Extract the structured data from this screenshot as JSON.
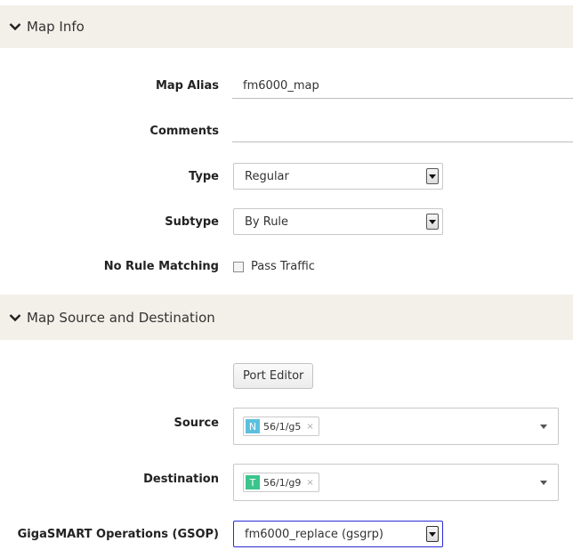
{
  "sections": {
    "map_info": {
      "title": "Map Info"
    },
    "map_source_destination": {
      "title": "Map Source and Destination"
    }
  },
  "map_info": {
    "map_alias": {
      "label": "Map Alias",
      "value": "fm6000_map"
    },
    "comments": {
      "label": "Comments",
      "value": ""
    },
    "type": {
      "label": "Type",
      "selected": "Regular"
    },
    "subtype": {
      "label": "Subtype",
      "selected": "By Rule"
    },
    "no_rule_matching": {
      "label": "No Rule Matching",
      "checkbox_label": "Pass Traffic",
      "checked": false
    }
  },
  "source_destination": {
    "port_editor_label": "Port Editor",
    "source": {
      "label": "Source",
      "tags": [
        {
          "badge": "N",
          "badge_color": "#5bc0de",
          "text": "56/1/g5",
          "remove": "×"
        }
      ]
    },
    "destination": {
      "label": "Destination",
      "tags": [
        {
          "badge": "T",
          "badge_color": "#3cc48d",
          "text": "56/1/g9",
          "remove": "×"
        }
      ]
    },
    "gsop": {
      "label": "GigaSMART Operations (GSOP)",
      "selected": "fm6000_replace (gsgrp)"
    }
  }
}
